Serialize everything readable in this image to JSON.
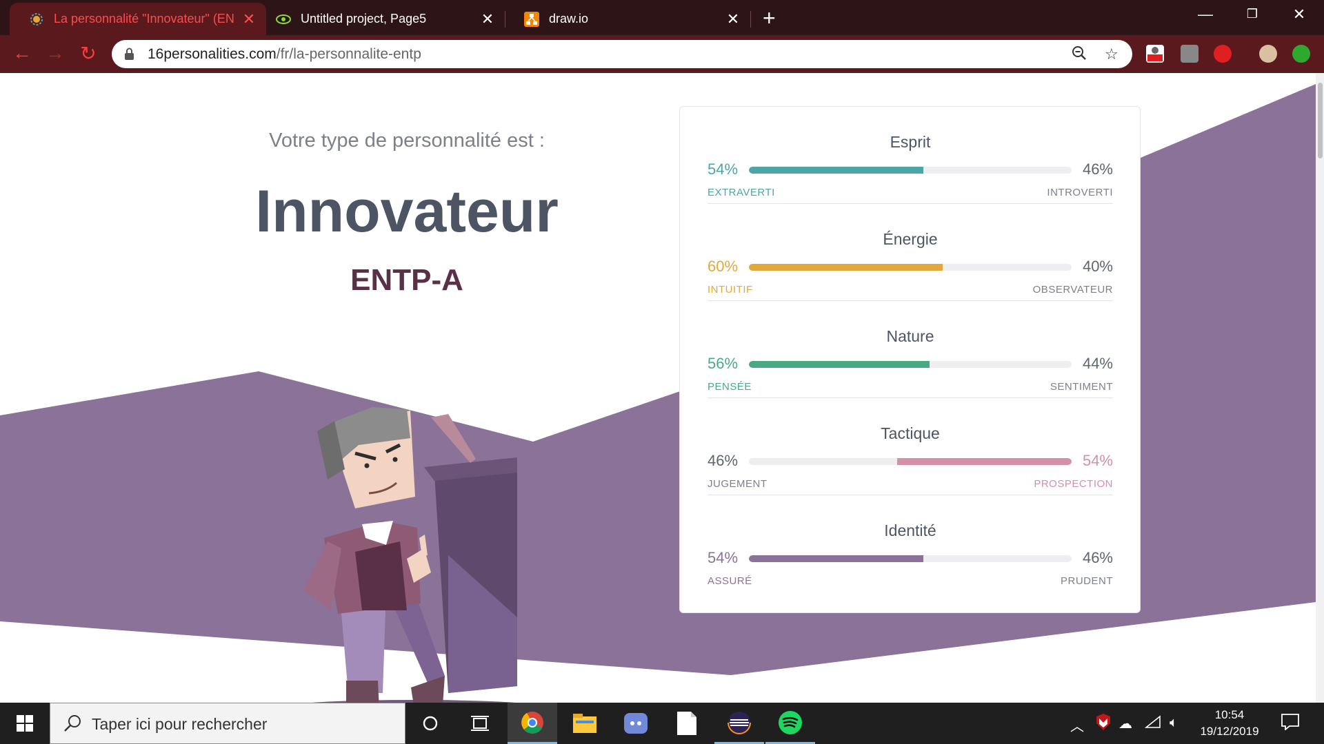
{
  "browser": {
    "tabs": [
      {
        "title": "La personnalité \"Innovateur\" (EN",
        "favicon": "16personalities-icon",
        "active": true
      },
      {
        "title": "Untitled project, Page5",
        "favicon": "eye-icon",
        "active": false
      },
      {
        "title": "draw.io",
        "favicon": "drawio-icon",
        "active": false
      }
    ],
    "url_domain": "16personalities.com",
    "url_path": "/fr/la-personnalite-entp",
    "accent_color": "#5a1a1d"
  },
  "page": {
    "intro": "Votre type de personnalité est :",
    "type_name": "Innovateur",
    "type_code": "ENTP-A",
    "bg_color": "#8b7299"
  },
  "traits": [
    {
      "name": "Esprit",
      "left_pct": "54%",
      "right_pct": "46%",
      "left_label": "EXTRAVERTI",
      "right_label": "INTROVERTI",
      "value": 0.54,
      "dominant": "left",
      "color": "#4ea5a8"
    },
    {
      "name": "Énergie",
      "left_pct": "60%",
      "right_pct": "40%",
      "left_label": "INTUITIF",
      "right_label": "OBSERVATEUR",
      "value": 0.6,
      "dominant": "left",
      "color": "#e3a83b"
    },
    {
      "name": "Nature",
      "left_pct": "56%",
      "right_pct": "44%",
      "left_label": "PENSÉE",
      "right_label": "SENTIMENT",
      "value": 0.56,
      "dominant": "left",
      "color": "#4aa884"
    },
    {
      "name": "Tactique",
      "left_pct": "46%",
      "right_pct": "54%",
      "left_label": "JUGEMENT",
      "right_label": "PROSPECTION",
      "value": 0.54,
      "dominant": "right",
      "color": "#d48fa9"
    },
    {
      "name": "Identité",
      "left_pct": "54%",
      "right_pct": "46%",
      "left_label": "ASSURÉ",
      "right_label": "PRUDENT",
      "value": 0.54,
      "dominant": "left",
      "color": "#8b7299"
    }
  ],
  "taskbar": {
    "search_placeholder": "Taper ici pour rechercher",
    "time": "10:54",
    "date": "19/12/2019"
  }
}
